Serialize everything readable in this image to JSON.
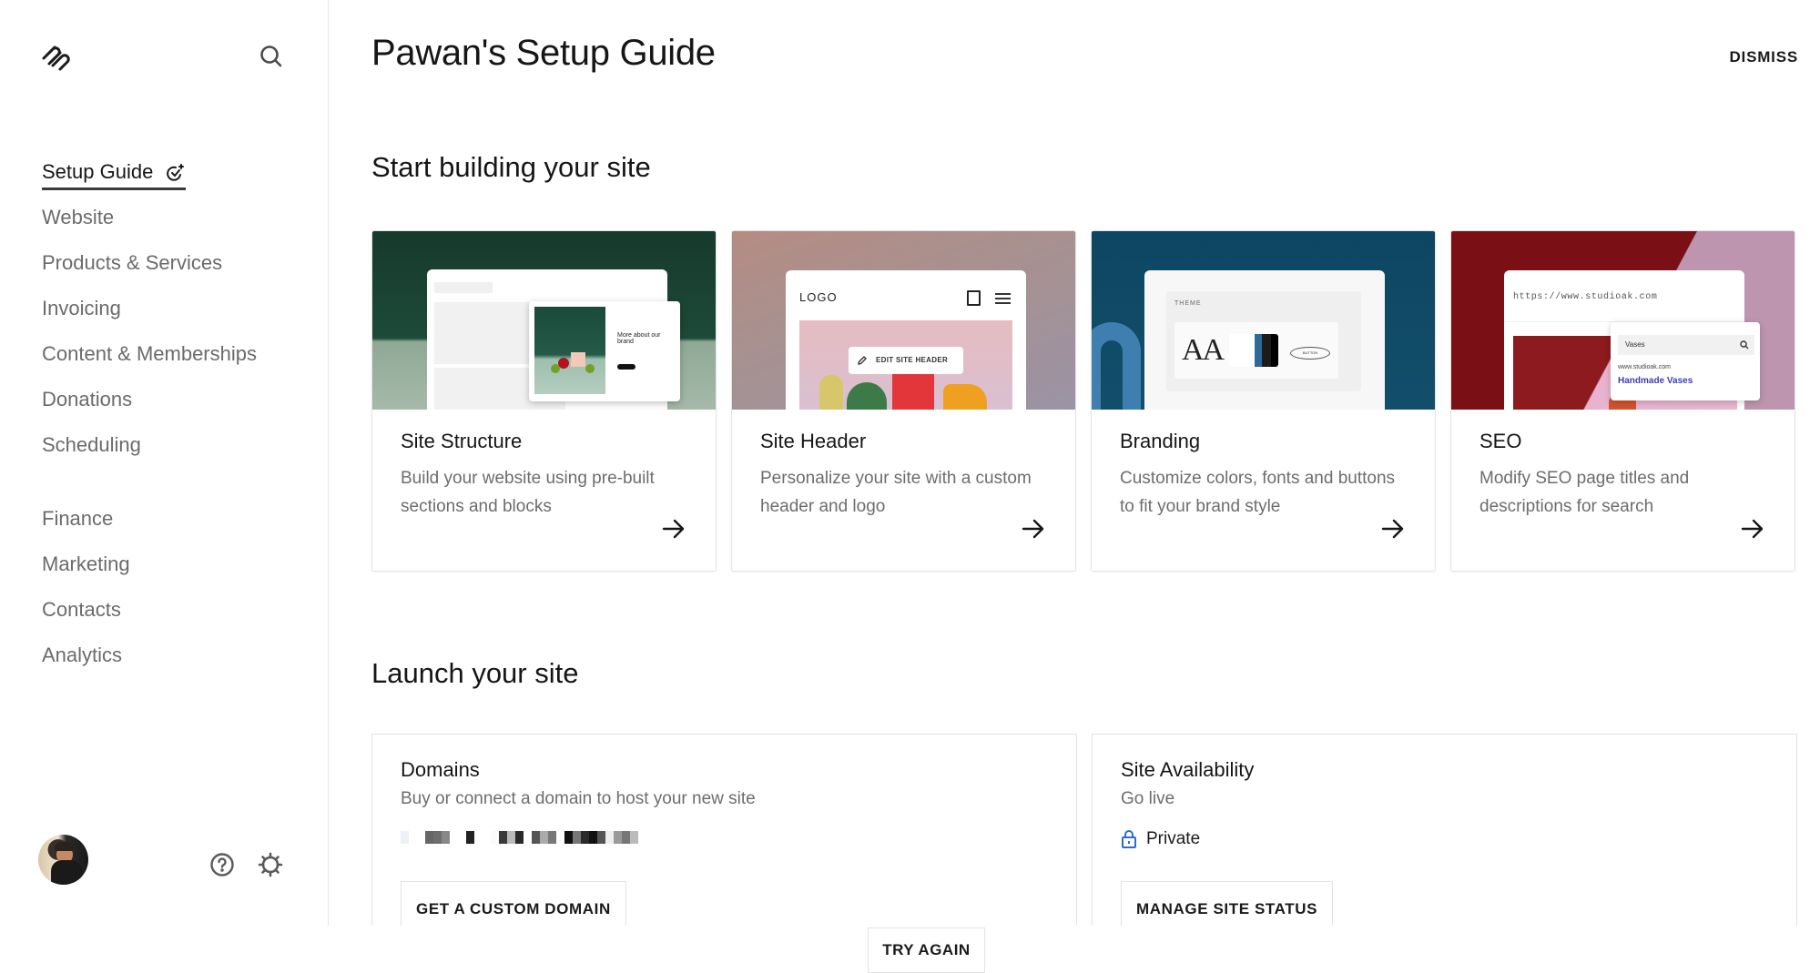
{
  "sidebar": {
    "logo_icon": "squarespace-logo-icon",
    "search_icon": "search-icon",
    "items": [
      {
        "label": "Setup Guide",
        "active": true,
        "icon": "check-sparkle-icon"
      },
      {
        "label": "Website"
      },
      {
        "label": "Products & Services"
      },
      {
        "label": "Invoicing"
      },
      {
        "label": "Content & Memberships"
      },
      {
        "label": "Donations"
      },
      {
        "label": "Scheduling"
      },
      {
        "label": "Finance"
      },
      {
        "label": "Marketing"
      },
      {
        "label": "Contacts"
      },
      {
        "label": "Analytics"
      }
    ],
    "footer": {
      "avatar_alt": "User avatar",
      "help_icon": "help-circle-icon",
      "settings_icon": "gear-icon"
    }
  },
  "header": {
    "title": "Pawan's Setup Guide",
    "dismiss_label": "DISMISS"
  },
  "build_section": {
    "title": "Start building your site",
    "cards": [
      {
        "title": "Site Structure",
        "description": "Build your website using pre-built sections and blocks",
        "image": {
          "heading": "More about our brand"
        }
      },
      {
        "title": "Site Header",
        "description": "Personalize your site with a custom header and logo",
        "image": {
          "logo_text": "LOGO",
          "edit_label": "EDIT SITE HEADER"
        }
      },
      {
        "title": "Branding",
        "description": "Customize colors, fonts and buttons to fit your brand style",
        "image": {
          "theme_label": "THEME",
          "font_sample": "AA",
          "button_sample": "BUTTON"
        }
      },
      {
        "title": "SEO",
        "description": "Modify SEO page titles and descriptions for search",
        "image": {
          "url": "https://www.studioak.com",
          "query": "Vases",
          "result_domain": "www.studioak.com",
          "result_title": "Handmade Vases"
        }
      }
    ]
  },
  "launch_section": {
    "title": "Launch your site",
    "domains": {
      "title": "Domains",
      "description": "Buy or connect a domain to host your new site",
      "domain_value_redacted": true,
      "button_label": "GET A CUSTOM DOMAIN"
    },
    "availability": {
      "title": "Site Availability",
      "description": "Go live",
      "status": "Private",
      "status_icon": "lock-icon",
      "status_color": "#2c6ecb",
      "button_label": "MANAGE SITE STATUS"
    }
  },
  "try_again_label": "TRY AGAIN"
}
